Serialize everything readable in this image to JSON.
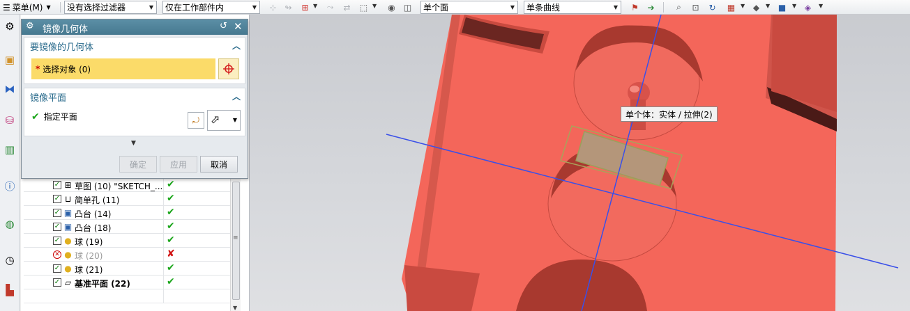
{
  "toolbar": {
    "menu_label": "菜单(M)",
    "filter_combo": "没有选择过滤器",
    "scope_combo": "仅在工作部件内",
    "face_rule_combo": "单个面",
    "curve_rule_combo": "单条曲线"
  },
  "dialog": {
    "title": "镜像几何体",
    "group1_title": "要镜像的几何体",
    "select_object_label": "选择对象 (0)",
    "group2_title": "镜像平面",
    "specify_plane_label": "指定平面",
    "ok_label": "确定",
    "apply_label": "应用",
    "cancel_label": "取消"
  },
  "navigator": {
    "rows": [
      {
        "label": "草图 (10) \"SKETCH_...",
        "icon": "sketch-icon",
        "state": "ok"
      },
      {
        "label": "简单孔 (11)",
        "icon": "hole-icon",
        "state": "ok"
      },
      {
        "label": "凸台 (14)",
        "icon": "boss-icon",
        "state": "ok"
      },
      {
        "label": "凸台 (18)",
        "icon": "boss-icon",
        "state": "ok"
      },
      {
        "label": "球 (19)",
        "icon": "sphere-icon",
        "state": "ok"
      },
      {
        "label": "球 (20)",
        "icon": "sphere-icon",
        "state": "error"
      },
      {
        "label": "球 (21)",
        "icon": "sphere-icon",
        "state": "ok"
      },
      {
        "label": "基准平面 (22)",
        "icon": "datum-plane-icon",
        "state": "ok"
      }
    ]
  },
  "viewport": {
    "tooltip": "单个体：实体 / 拉伸(2)",
    "colors": {
      "part": "#f4665a",
      "part_dark": "#d44a40",
      "axis": "#3a50e8",
      "highlight": "#b6a46a"
    }
  }
}
